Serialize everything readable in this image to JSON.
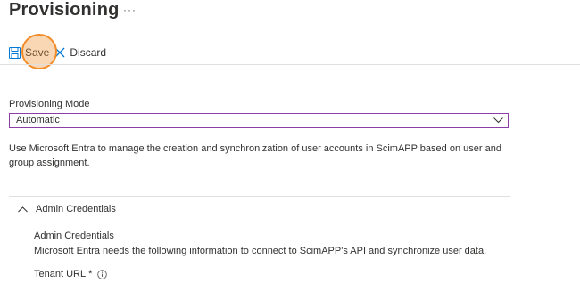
{
  "header": {
    "title": "Provisioning",
    "more_label": "···"
  },
  "toolbar": {
    "save_label": "Save",
    "discard_label": "Discard"
  },
  "provisioning_mode": {
    "label": "Provisioning Mode",
    "selected": "Automatic"
  },
  "description": "Use Microsoft Entra to manage the creation and synchronization of user accounts in ScimAPP based on user and group assignment.",
  "admin_credentials": {
    "section_label": "Admin Credentials",
    "title": "Admin Credentials",
    "description": "Microsoft Entra needs the following information to connect to ScimAPP's API and synchronize user data.",
    "tenant_url_label": "Tenant URL",
    "required_marker": "*"
  },
  "colors": {
    "accent": "#0078d4",
    "select_border": "#8a3ea6",
    "highlight": "#f28c28"
  }
}
